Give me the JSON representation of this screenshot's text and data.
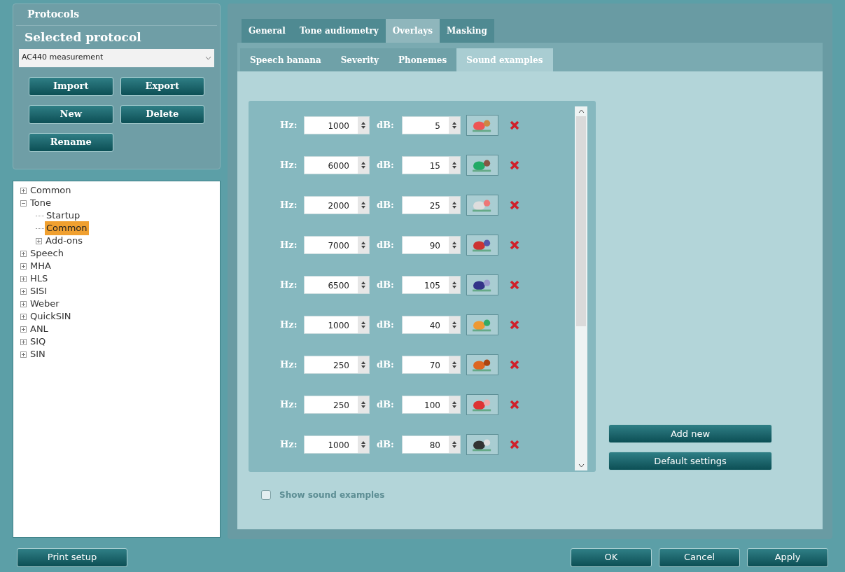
{
  "protocols_panel": {
    "title": "Protocols",
    "selected_protocol_label": "Selected protocol",
    "protocol_dropdown": {
      "value": "AC440 measurement"
    },
    "buttons": [
      "Import",
      "Export",
      "New",
      "Delete",
      "Rename"
    ]
  },
  "tree": [
    {
      "label": "Common",
      "selected": false,
      "expanded": false
    },
    {
      "label": "Tone",
      "selected": false,
      "expanded": true,
      "children": [
        {
          "label": "Startup",
          "selected": false
        },
        {
          "label": "Common",
          "selected": true
        },
        {
          "label": "Add-ons",
          "selected": false,
          "expanded": false
        }
      ]
    },
    {
      "label": "Speech",
      "selected": false,
      "expanded": false
    },
    {
      "label": "MHA",
      "selected": false,
      "expanded": false
    },
    {
      "label": "HLS",
      "selected": false,
      "expanded": false
    },
    {
      "label": "SISI",
      "selected": false,
      "expanded": false
    },
    {
      "label": "Weber",
      "selected": false,
      "expanded": false
    },
    {
      "label": "QuickSIN",
      "selected": false,
      "expanded": false
    },
    {
      "label": "ANL",
      "selected": false,
      "expanded": false
    },
    {
      "label": "SIQ",
      "selected": false,
      "expanded": false
    },
    {
      "label": "SIN",
      "selected": false,
      "expanded": false
    }
  ],
  "tabs": [
    {
      "label": "General",
      "selected": false
    },
    {
      "label": "Tone audiometry",
      "selected": false
    },
    {
      "label": "Overlays",
      "selected": true
    },
    {
      "label": "Masking",
      "selected": false
    }
  ],
  "subtabs": [
    {
      "label": "Speech banana",
      "selected": false
    },
    {
      "label": "Severity",
      "selected": false
    },
    {
      "label": "Phonemes",
      "selected": false
    },
    {
      "label": "Sound examples",
      "selected": true
    }
  ],
  "sound_examples": [
    {
      "hz_label": "Hz:",
      "hz": "1000",
      "db_label": "dB:",
      "db": "5"
    },
    {
      "hz_label": "Hz:",
      "hz": "6000",
      "db_label": "dB:",
      "db": "15"
    },
    {
      "hz_label": "Hz:",
      "hz": "2000",
      "db_label": "dB:",
      "db": "25"
    },
    {
      "hz_label": "Hz:",
      "hz": "7000",
      "db_label": "dB:",
      "db": "90"
    },
    {
      "hz_label": "Hz:",
      "hz": "6500",
      "db_label": "dB:",
      "db": "105"
    },
    {
      "hz_label": "Hz:",
      "hz": "1000",
      "db_label": "dB:",
      "db": "40"
    },
    {
      "hz_label": "Hz:",
      "hz": "250",
      "db_label": "dB:",
      "db": "70"
    },
    {
      "hz_label": "Hz:",
      "hz": "250",
      "db_label": "dB:",
      "db": "100"
    },
    {
      "hz_label": "Hz:",
      "hz": "1000",
      "db_label": "dB:",
      "db": "80"
    }
  ],
  "side_buttons": [
    "Add new",
    "Default settings"
  ],
  "show_checkbox": {
    "label": "Show sound examples",
    "checked": false,
    "disabled": true
  },
  "footer": {
    "left_button": "Print setup",
    "buttons": [
      "OK",
      "Cancel",
      "Apply"
    ]
  }
}
